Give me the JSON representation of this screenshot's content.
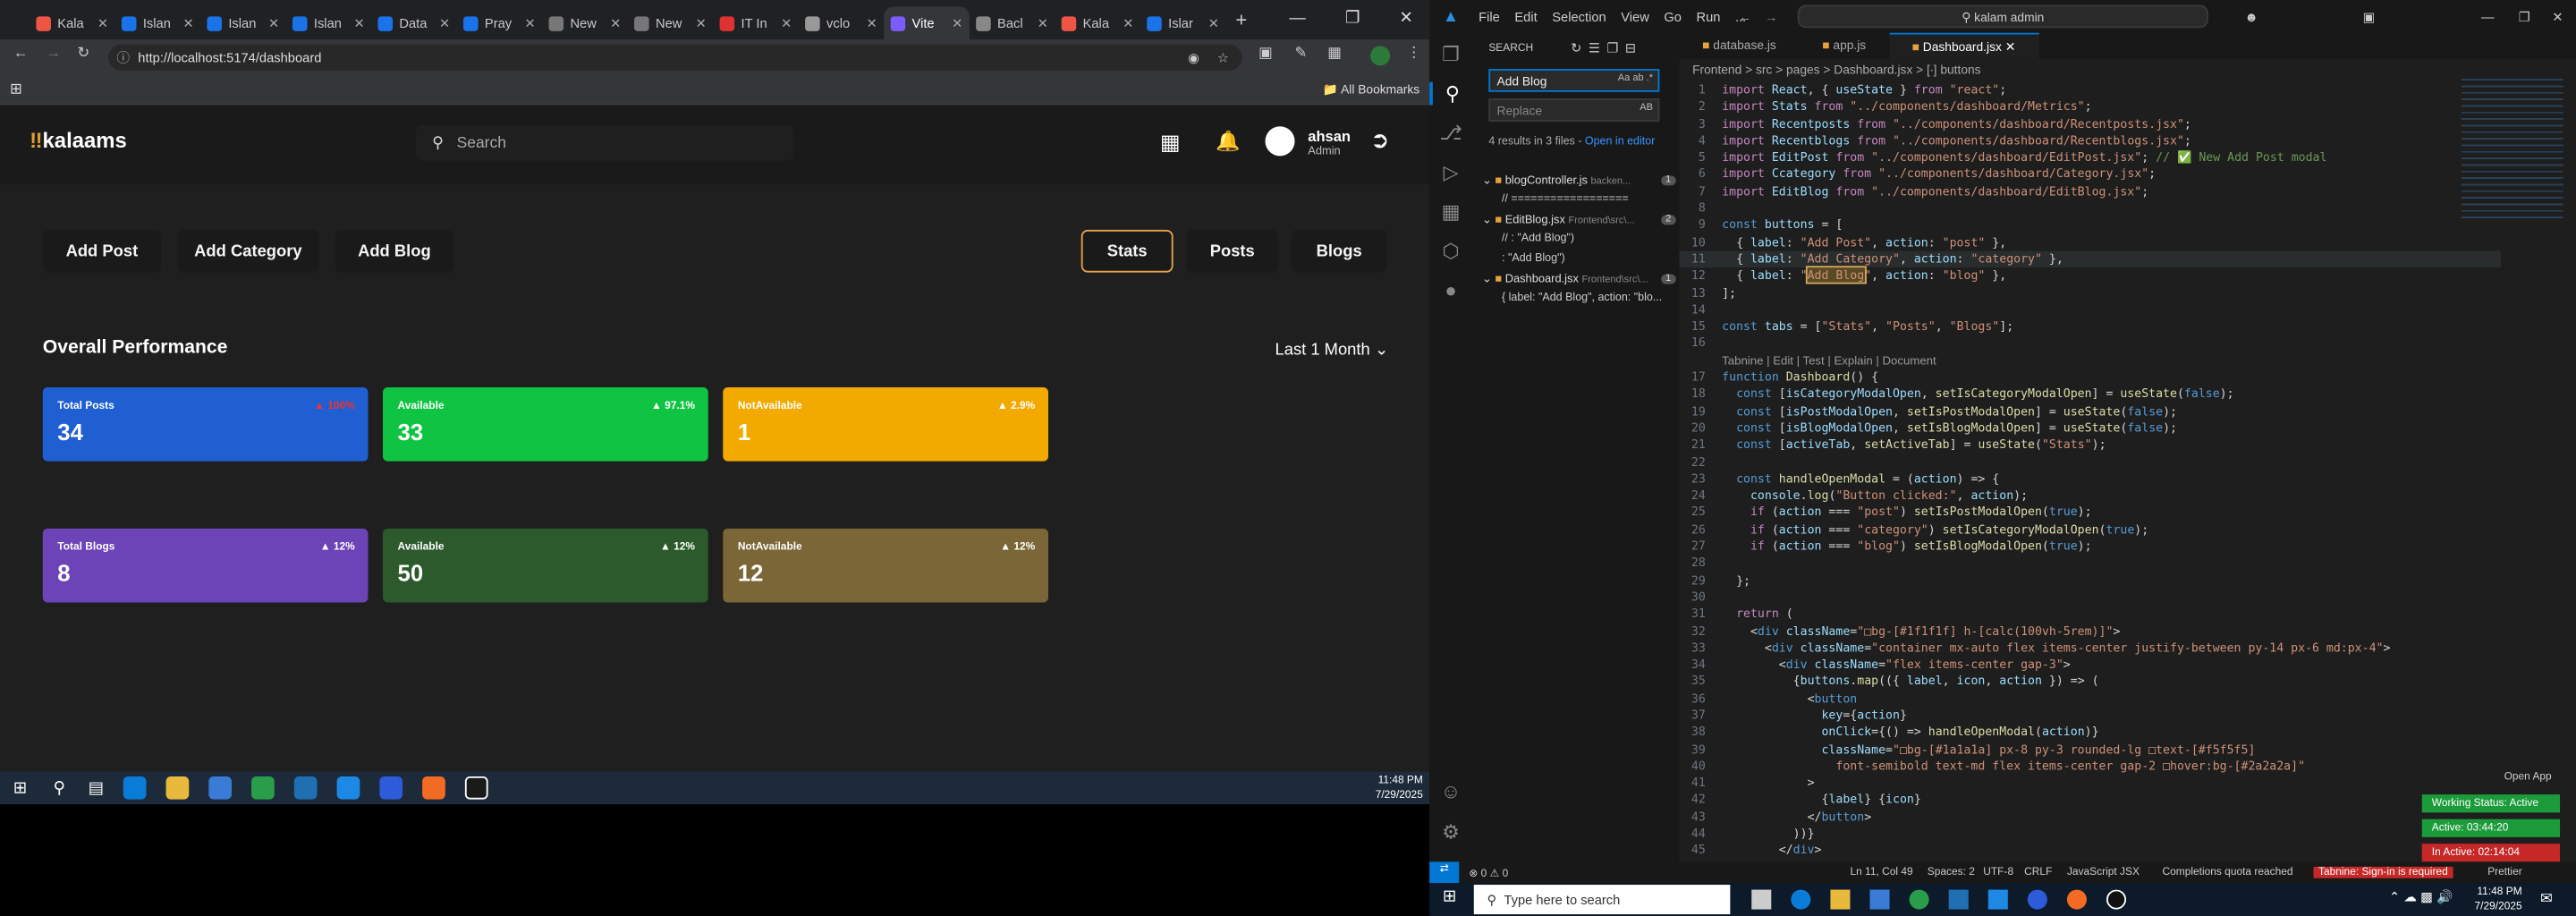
{
  "browser": {
    "tabs": [
      {
        "label": "Kala",
        "color": "#e54"
      },
      {
        "label": "Islan",
        "color": "#1a73e8"
      },
      {
        "label": "Islan",
        "color": "#1a73e8"
      },
      {
        "label": "Islan",
        "color": "#1a73e8"
      },
      {
        "label": "Data",
        "color": "#1a73e8"
      },
      {
        "label": "Pray",
        "color": "#1a73e8"
      },
      {
        "label": "New",
        "color": "#777"
      },
      {
        "label": "New",
        "color": "#777"
      },
      {
        "label": "IT In",
        "color": "#d33"
      },
      {
        "label": "vclo",
        "color": "#999"
      },
      {
        "label": "Vite",
        "color": "#7c5cfc",
        "active": true
      },
      {
        "label": "Bacl",
        "color": "#888"
      },
      {
        "label": "Kala",
        "color": "#e54"
      },
      {
        "label": "Islar",
        "color": "#1a73e8"
      }
    ],
    "url": "http://localhost:5174/dashboard",
    "bookmarks": "All Bookmarks"
  },
  "app": {
    "logo_text": "kalaams",
    "search_placeholder": "Search",
    "user_name": "ahsan",
    "user_role": "Admin",
    "actions": [
      "Add Post",
      "Add Category",
      "Add Blog"
    ],
    "tabs": [
      "Stats",
      "Posts",
      "Blogs"
    ],
    "active_tab": "Stats",
    "section_title": "Overall Performance",
    "period": "Last 1 Month",
    "post_cards": [
      {
        "title": "Total Posts",
        "value": "34",
        "change": "100%",
        "color": "#1f5fd1",
        "change_color": "#e33"
      },
      {
        "title": "Available",
        "value": "33",
        "change": "97.1%",
        "color": "#10c443"
      },
      {
        "title": "NotAvailable",
        "value": "1",
        "change": "2.9%",
        "color": "#f2a900"
      }
    ],
    "blog_cards": [
      {
        "title": "Total Blogs",
        "value": "8",
        "change": "12%",
        "color": "#6c44b8"
      },
      {
        "title": "Available",
        "value": "50",
        "change": "12%",
        "color": "#2c5a2c"
      },
      {
        "title": "NotAvailable",
        "value": "12",
        "change": "12%",
        "color": "#7a6636"
      }
    ]
  },
  "taskbar_left": {
    "time": "11:48 PM",
    "date": "7/29/2025"
  },
  "vscode": {
    "menu": [
      "File",
      "Edit",
      "Selection",
      "View",
      "Go",
      "Run",
      "..."
    ],
    "command_center": "kalam admin",
    "search": {
      "title": "SEARCH",
      "query": "Add Blog",
      "replace": "Replace",
      "summary": "4 results in 3 files - ",
      "open_link": "Open in editor",
      "files": [
        {
          "name": "blogController.js",
          "path": "backen...",
          "count": "1",
          "lines": [
            "// =================="
          ]
        },
        {
          "name": "EditBlog.jsx",
          "path": "Frontend\\src\\...",
          "count": "2",
          "lines": [
            "//           : \"Add Blog\")",
            ": \"Add Blog\")"
          ]
        },
        {
          "name": "Dashboard.jsx",
          "path": "Frontend\\src\\...",
          "count": "1",
          "lines": [
            "{ label: \"Add Blog\", action: \"blo..."
          ]
        }
      ]
    },
    "editor_tabs": [
      {
        "label": "database.js"
      },
      {
        "label": "app.js"
      },
      {
        "label": "Dashboard.jsx",
        "active": true
      }
    ],
    "breadcrumb": "Frontend > src > pages > Dashboard.jsx > [∙] buttons",
    "codelens": "Tabnine | Edit | Test | Explain | Document",
    "status": {
      "errors": "⊗ 0 ⚠ 0",
      "pos": "Ln 11, Col 49",
      "spaces": "Spaces: 2",
      "enc": "UTF-8",
      "eol": "CRLF",
      "lang": "JavaScript JSX",
      "quota": "Completions quota reached",
      "tabnine": "Tabnine: Sign-in is required",
      "prettier": "Prettier"
    },
    "open_app": "Open App",
    "work_status": "Working Status: Active",
    "active_time": "Active: 03:44:20",
    "inactive_time": "In Active: 02:14:04"
  },
  "taskbar_right": {
    "search": "Type here to search",
    "time": "11:48 PM",
    "date": "7/29/2025"
  }
}
